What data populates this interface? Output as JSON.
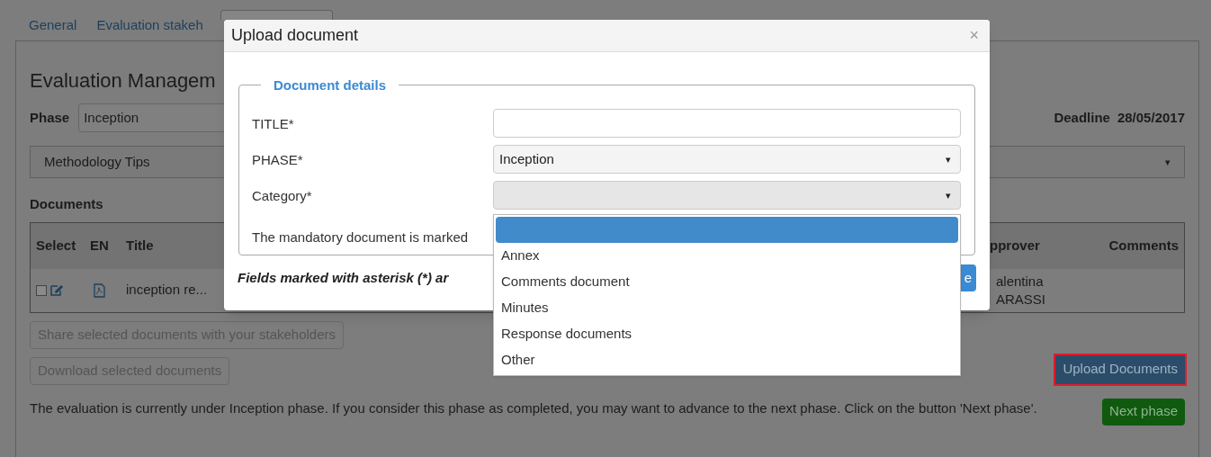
{
  "tabs": [
    {
      "label": "General",
      "selected": false
    },
    {
      "label": "Evaluation stakeh",
      "selected": false
    },
    {
      "selected": true
    }
  ],
  "page_title": "Evaluation Managem",
  "phase": {
    "label": "Phase",
    "value": "Inception"
  },
  "deadline": {
    "label": "Deadline",
    "value": "28/05/2017"
  },
  "methodology_tips": {
    "label": "Methodology Tips",
    "caret": "▾"
  },
  "documents_heading": "Documents",
  "table": {
    "columns": [
      "Select",
      "EN",
      "Title",
      "pprover",
      "Comments"
    ],
    "rows": [
      {
        "checked": false,
        "title": "inception re...",
        "approver": [
          "alentina",
          "ARASSI"
        ]
      }
    ]
  },
  "buttons": [
    {
      "label": "Share selected documents with your stakeholders",
      "disabled": true
    },
    {
      "label": "Download selected documents",
      "disabled": true
    }
  ],
  "upload_button": {
    "label": "Upload Documents",
    "highlighted": true
  },
  "notice": "The evaluation is currently under Inception phase. If you consider this phase as completed, you may want to advance to the next phase. Click on the button 'Next phase'.",
  "next_button": "Next phase",
  "modal": {
    "title": "Upload document",
    "close": "×",
    "legend": "Document details",
    "fields": [
      {
        "label": "TITLE*",
        "kind": "text"
      },
      {
        "label": "PHASE*",
        "kind": "select",
        "value": "Inception",
        "caret": "▾"
      },
      {
        "label": "Category*",
        "kind": "select",
        "caret": "▾",
        "focused": true
      }
    ],
    "mandatory_note": "The mandatory document is marked",
    "footer_note": "Fields marked with asterisk (*) ar",
    "footer_button": "e"
  },
  "dropdown": {
    "options": [
      {
        "selected": true
      },
      {
        "label": "Annex",
        "selected": false
      },
      {
        "label": "Comments document",
        "selected": false
      },
      {
        "label": "Minutes",
        "selected": false
      },
      {
        "label": "Response documents",
        "selected": false
      },
      {
        "label": "Other",
        "selected": false
      }
    ]
  }
}
